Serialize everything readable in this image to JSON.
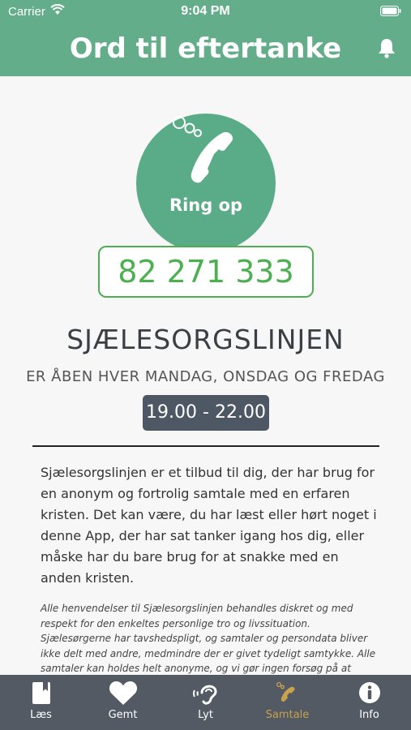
{
  "status_bar": {
    "carrier": "Carrier",
    "time": "9:04 PM"
  },
  "header": {
    "title": "Ord til eftertanke",
    "bell_icon": "bell-icon"
  },
  "call": {
    "label": "Ring op",
    "phone_number": "82 271 333"
  },
  "service": {
    "name": "SJÆLESORGSLINJEN",
    "open_days": "ER ÅBEN HVER MANDAG, ONSDAG OG FREDAG",
    "hours": "19.00 - 22.00"
  },
  "description": "Sjælesorgslinjen er et tilbud til dig, der har brug for en anonym og fortrolig samtale med en erfaren kristen. Det kan være, du har læst eller hørt noget i denne App, der har sat tanker igang hos dig, eller måske har du bare brug for at snakke med en anden kristen.",
  "disclaimer": "Alle henvendelser til Sjælesorgslinjen behandles diskret og med respekt for den enkeltes personlige tro og livssituation. Sjælesørgerne har tavshedspligt, og samtaler og persondata bliver ikke delt med andre, medmindre der er givet tydeligt samtykke. Alle samtaler kan holdes helt anonyme, og vi gør ingen forsøg på at",
  "tabs": [
    {
      "label": "Læs",
      "icon": "book-icon"
    },
    {
      "label": "Gemt",
      "icon": "heart-icon"
    },
    {
      "label": "Lyt",
      "icon": "ear-icon"
    },
    {
      "label": "Samtale",
      "icon": "phone-icon",
      "active": true
    },
    {
      "label": "Info",
      "icon": "info-icon"
    }
  ],
  "colors": {
    "header_green": "#63ad8b",
    "circle_green": "#5aab88",
    "number_green": "#4caf50",
    "tab_bar": "#535a63",
    "active_tab": "#c9a24e",
    "hours_badge": "#4e5865"
  }
}
